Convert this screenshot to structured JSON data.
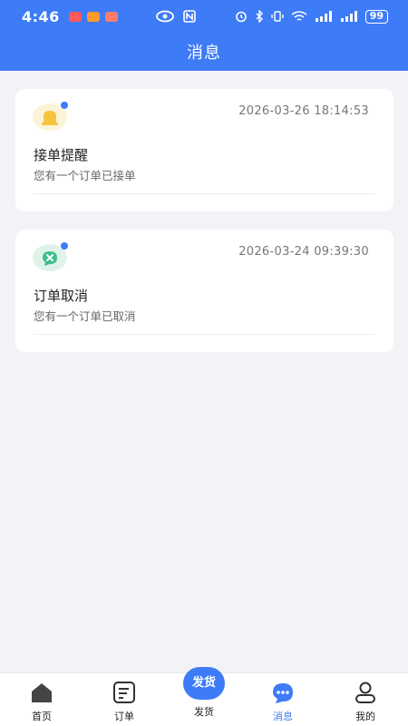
{
  "status_bar": {
    "time": "4:46",
    "battery": "99"
  },
  "header": {
    "title": "消息"
  },
  "messages": [
    {
      "title": "接单提醒",
      "desc": "您有一个订单已接单",
      "time": "2026-03-26 18:14:53",
      "icon": "bell-icon"
    },
    {
      "title": "订单取消",
      "desc": "您有一个订单已取消",
      "time": "2026-03-24 09:39:30",
      "icon": "cancel-chat-icon"
    }
  ],
  "tabbar": {
    "home": "首页",
    "orders": "订单",
    "ship_button": "发货",
    "ship_label": "发货",
    "messages": "消息",
    "mine": "我的"
  },
  "colors": {
    "accent": "#3d7bf7",
    "bell": "#f5c542",
    "cancel": "#3cbf8a"
  }
}
